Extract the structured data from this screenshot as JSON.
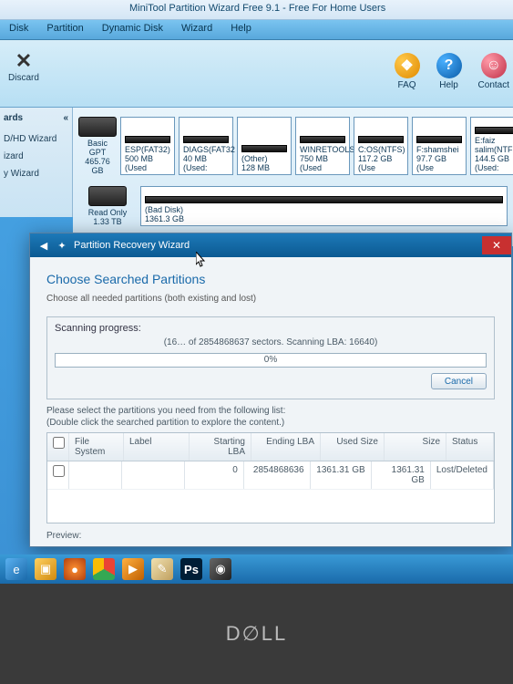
{
  "window": {
    "title": "MiniTool Partition Wizard Free 9.1 - Free For Home Users"
  },
  "menu": {
    "disk": "Disk",
    "partition": "Partition",
    "dynamic": "Dynamic Disk",
    "wizard": "Wizard",
    "help": "Help"
  },
  "toolbar": {
    "discard": "Discard",
    "faq": "FAQ",
    "help": "Help",
    "contact": "Contact"
  },
  "leftpanel": {
    "header": "ards",
    "items": [
      "D/HD Wizard",
      "izard",
      "y Wizard"
    ]
  },
  "disks": [
    {
      "label": "Basic GPT",
      "size": "465.76 GB",
      "partitions": [
        {
          "name": "ESP(FAT32)",
          "detail": "500 MB (Used"
        },
        {
          "name": "DIAGS(FAT32",
          "detail": "40 MB (Used:"
        },
        {
          "name": "(Other)",
          "detail": "128 MB"
        },
        {
          "name": "WINRETOOLS",
          "detail": "750 MB (Used"
        },
        {
          "name": "C:OS(NTFS)",
          "detail": "117.2 GB (Use"
        },
        {
          "name": "F:shamshei",
          "detail": "97.7 GB (Use"
        },
        {
          "name": "E:faiz salim(NTF",
          "detail": "144.5 GB (Used:"
        }
      ]
    },
    {
      "label": "Read Only",
      "size": "1.33 TB",
      "partitions": [
        {
          "name": "(Bad Disk)",
          "detail": "1361.3 GB"
        }
      ]
    }
  ],
  "dialog": {
    "title": "Partition Recovery Wizard",
    "heading": "Choose Searched Partitions",
    "subtitle": "Choose all needed partitions (both existing and lost)",
    "scan_label": "Scanning progress:",
    "scan_info": "(16… of 2854868637 sectors. Scanning LBA: 16640)",
    "progress_pct": "0%",
    "cancel": "Cancel",
    "instruction": "Please select the partitions you need from the following list:\n(Double click the searched partition to explore the content.)",
    "columns": {
      "fs": "File System",
      "label": "Label",
      "slba": "Starting LBA",
      "elba": "Ending LBA",
      "used": "Used Size",
      "size": "Size",
      "status": "Status"
    },
    "rows": [
      {
        "fs": "",
        "label": "",
        "slba": "0",
        "elba": "2854868636",
        "used": "1361.31 GB",
        "size": "1361.31 GB",
        "status": "Lost/Deleted"
      }
    ],
    "preview": "Preview:"
  },
  "taskbar": {
    "items": [
      "ie",
      "folder",
      "firefox",
      "chrome",
      "media",
      "paint",
      "photoshop",
      "minitool"
    ]
  }
}
